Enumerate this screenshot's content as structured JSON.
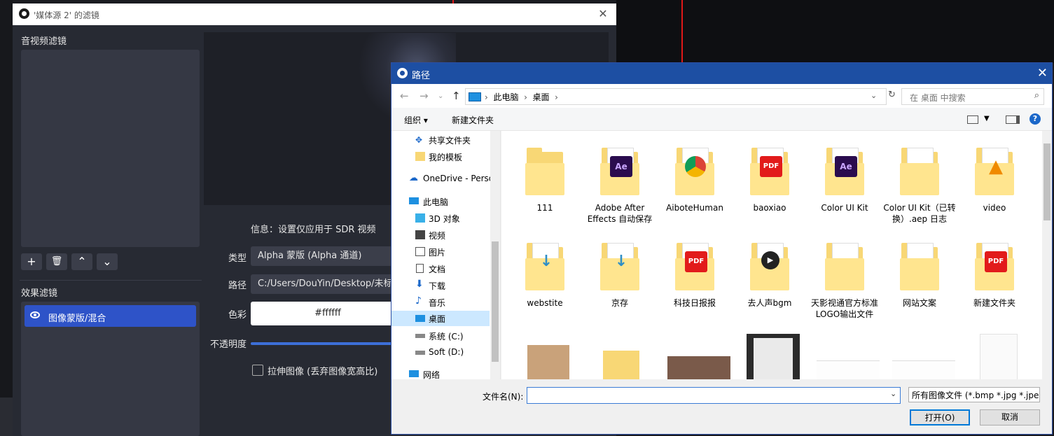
{
  "filter_window": {
    "title": "'媒体源 2' 的滤镜",
    "av_filters_label": "音视频滤镜",
    "effects_label": "效果滤镜",
    "effect_item": "图像蒙版/混合",
    "info": "信息：设置仅应用于 SDR 视频",
    "type_label": "类型",
    "type_value": "Alpha 蒙版 (Alpha 通道)",
    "path_label": "路径",
    "path_value": "C:/Users/DouYin/Desktop/未标题",
    "color_label": "色彩",
    "color_value": "#ffffff",
    "opacity_label": "不透明度",
    "stretch_label": "拉伸图像 (丢弃图像宽高比)",
    "toolbar": {
      "add": "+",
      "remove": "🗑",
      "up": "⌃",
      "down": "⌄"
    }
  },
  "file_dialog": {
    "title": "路径",
    "address": {
      "root": "此电脑",
      "current": "桌面"
    },
    "search_placeholder": "在 桌面 中搜索",
    "toolbar": {
      "organize": "组织 ▾",
      "new_folder": "新建文件夹"
    },
    "nav": [
      {
        "label": "共享文件夹",
        "icon": "shared-folder-icon"
      },
      {
        "label": "我的模板",
        "icon": "folder-icon"
      },
      {
        "label": "OneDrive - Perso",
        "icon": "onedrive-icon"
      },
      {
        "label": "此电脑",
        "icon": "pc-icon"
      },
      {
        "label": "3D 对象",
        "icon": "3d-icon"
      },
      {
        "label": "视频",
        "icon": "video-icon"
      },
      {
        "label": "图片",
        "icon": "picture-icon"
      },
      {
        "label": "文档",
        "icon": "document-icon"
      },
      {
        "label": "下载",
        "icon": "download-icon"
      },
      {
        "label": "音乐",
        "icon": "music-icon"
      },
      {
        "label": "桌面",
        "icon": "desktop-icon"
      },
      {
        "label": "系统 (C:)",
        "icon": "drive-icon"
      },
      {
        "label": "Soft (D:)",
        "icon": "drive-icon"
      },
      {
        "label": "网络",
        "icon": "network-icon"
      }
    ],
    "files_row1": [
      {
        "name": "111",
        "badge": ""
      },
      {
        "name": "Adobe After Effects 自动保存",
        "badge": "Ae"
      },
      {
        "name": "AiboteHuman",
        "badge": ""
      },
      {
        "name": "baoxiao",
        "badge": "PDF"
      },
      {
        "name": "Color UI Kit",
        "badge": "Ae"
      },
      {
        "name": "Color UI Kit（已转换）.aep 日志",
        "badge": ""
      },
      {
        "name": "video",
        "badge": "▲"
      }
    ],
    "files_row2": [
      {
        "name": "webstite",
        "badge": "↓"
      },
      {
        "name": "京存",
        "badge": "↓"
      },
      {
        "name": "科技日报报",
        "badge": "PDF"
      },
      {
        "name": "去人声bgm",
        "badge": "▶"
      },
      {
        "name": "天影视通官方标准LOGO输出文件",
        "badge": ""
      },
      {
        "name": "网站文案",
        "badge": ""
      },
      {
        "name": "新建文件夹",
        "badge": "PDF"
      }
    ],
    "filename_label": "文件名(N):",
    "filename_value": "",
    "filetype": "所有图像文件 (*.bmp *.jpg *.jpeg",
    "open_label": "打开(O)",
    "cancel_label": "取消",
    "colors": {
      "accent": "#1d4fa3",
      "ae": "#2a0c4e",
      "pdf": "#e21b1b",
      "vlc": "#f08a00"
    }
  }
}
